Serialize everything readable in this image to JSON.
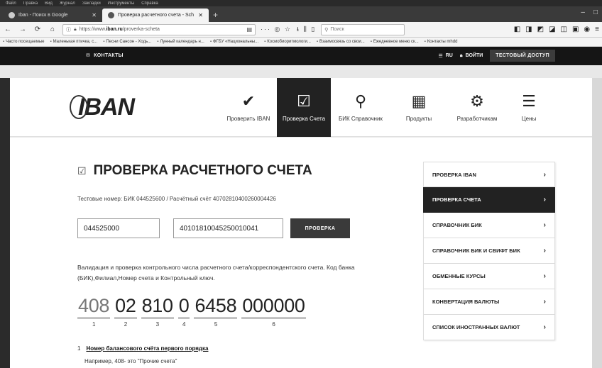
{
  "browser": {
    "menubar": [
      "Файл",
      "Правка",
      "Вид",
      "Журнал",
      "Закладки",
      "Инструменты",
      "Справка"
    ],
    "tabs": [
      {
        "label": "Iban - Поиск в Google",
        "active": false
      },
      {
        "label": "Проверка расчетного счета - Sch",
        "active": true
      }
    ],
    "url": "https://www.",
    "url_host": "iban.ru",
    "url_path": "/proverka-scheta",
    "search_placeholder": "Поиск",
    "bookmarks": [
      "Часто посещаемые",
      "Маленькая птичка, с...",
      "Песни Сансон - Ходь...",
      "Лунный календарь н...",
      "ФГБУ «Национальны...",
      "Космобиоритмологи...",
      "Взаимосвязь со свои...",
      "Ежедневное меню ск...",
      "Контакты mhdd"
    ]
  },
  "site": {
    "contacts_label": "КОНТАКТЫ",
    "lang_label": "RU",
    "login_label": "ВОЙТИ",
    "test_access_label": "ТЕСТОВЫЙ ДОСТУП",
    "logo_text": "IBAN",
    "nav": [
      {
        "label": "Проверить IBAN",
        "icon": "✔",
        "active": false
      },
      {
        "label": "Проверка Счета",
        "icon": "☑",
        "active": true
      },
      {
        "label": "БИК Справочник",
        "icon": "⚲",
        "active": false
      },
      {
        "label": "Продукты",
        "icon": "▦",
        "active": false
      },
      {
        "label": "Разработчикам",
        "icon": "⚙",
        "active": false
      },
      {
        "label": "Цены",
        "icon": "☰",
        "active": false
      }
    ]
  },
  "main": {
    "title": "ПРОВЕРКА РАСЧЕТНОГО СЧЕТА",
    "test_numbers": "Тестовые номер: БИК 044525600 / Расчётный счёт 40702810400260004426",
    "bik_value": "044525000",
    "account_value": "40101810045250010041",
    "check_button": "ПРОВЕРКА",
    "description": "Валидация и проверка контрольного числа расчетного счета/корреспондентского счета. Код банка (БИК),Филиал,Номер счета и Контрольный ключ.",
    "account_segments": [
      {
        "value": "408",
        "index": "1"
      },
      {
        "value": "02",
        "index": "2"
      },
      {
        "value": "810",
        "index": "3"
      },
      {
        "value": "0",
        "index": "4"
      },
      {
        "value": "6458",
        "index": "5"
      },
      {
        "value": "000000",
        "index": "6"
      }
    ],
    "note_number": "1",
    "note_link": "Номер балансового счёта первого порядка",
    "note_example": "Например, 408- это \"Прочие счета\""
  },
  "sidebar": {
    "items": [
      {
        "label": "ПРОВЕРКА IBAN",
        "active": false
      },
      {
        "label": "ПРОВЕРКА СЧЕТА",
        "active": true
      },
      {
        "label": "СПРАВОЧНИК БИК",
        "active": false
      },
      {
        "label": "СПРАВОЧНИК БИК И СВИФТ БИК",
        "active": false
      },
      {
        "label": "ОБМЕННЫЕ КУРСЫ",
        "active": false
      },
      {
        "label": "КОНВЕРТАЦИЯ ВАЛЮТЫ",
        "active": false
      },
      {
        "label": "СПИСОК ИНОСТРАННЫХ ВАЛЮТ",
        "active": false
      }
    ]
  }
}
